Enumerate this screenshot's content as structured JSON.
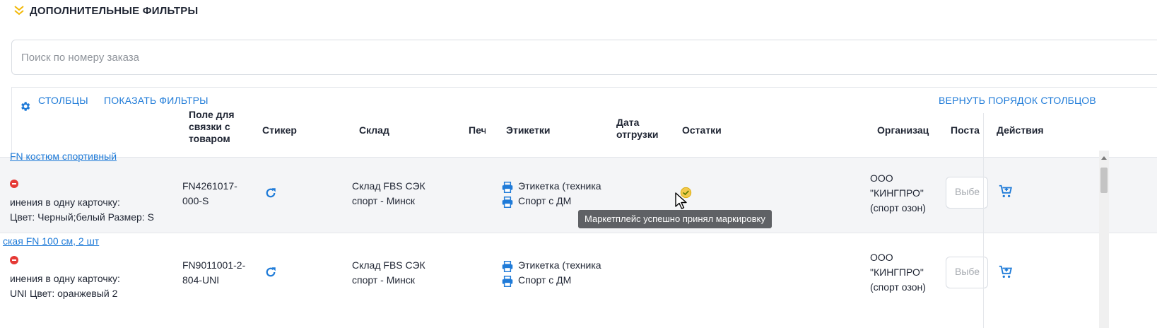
{
  "filters": {
    "title": "ДОПОЛНИТЕЛЬНЫЕ ФИЛЬТРЫ"
  },
  "search": {
    "placeholder": "Поиск по номеру заказа"
  },
  "toolbar": {
    "columns": "СТОЛБЦЫ",
    "show_filters": "ПОКАЗАТЬ ФИЛЬТРЫ",
    "reset_order": "ВЕРНУТЬ ПОРЯДОК СТОЛБЦОВ"
  },
  "columns": {
    "link_field": "Поле для связки с товаром",
    "sticker": "Стикер",
    "warehouse": "Склад",
    "print": "Печ",
    "labels": "Этикетки",
    "ship_date": "Дата отгрузки",
    "stock": "Остатки",
    "organization": "Организац",
    "supplier": "Поста",
    "actions": "Действия"
  },
  "rows": [
    {
      "product_link": "FN костюм спортивный",
      "merge_text": "инения в одну карточку:",
      "attrs": "Цвет: Черный;белый Размер: S",
      "sku": "FN4261017-000-S",
      "warehouse": "Склад FBS СЭК спорт - Минск",
      "label_tech": "Этикетка (техника",
      "label_dm": "Спорт с ДМ",
      "organization": "ООО \"КИНГПРО\" (спорт озон)",
      "select_placeholder": "Выбе"
    },
    {
      "product_link": "ская FN 100 см, 2 шт",
      "merge_text": "инения в одну карточку:",
      "attrs": "UNI Цвет: оранжевый 2",
      "sku": "FN9011001-2-804-UNI",
      "warehouse": "Склад FBS СЭК спорт - Минск",
      "label_tech": "Этикетка (техника",
      "label_dm": "Спорт с ДМ",
      "organization": "ООО \"КИНГПРО\" (спорт озон)",
      "select_placeholder": "Выбе"
    }
  ],
  "tooltip": {
    "text": "Маркетплейс успешно принял маркировку"
  },
  "colors": {
    "accent": "#1f7bd8",
    "chevron": "#f2b705",
    "danger": "#e53935",
    "tooltip_bg": "#5f6165"
  }
}
